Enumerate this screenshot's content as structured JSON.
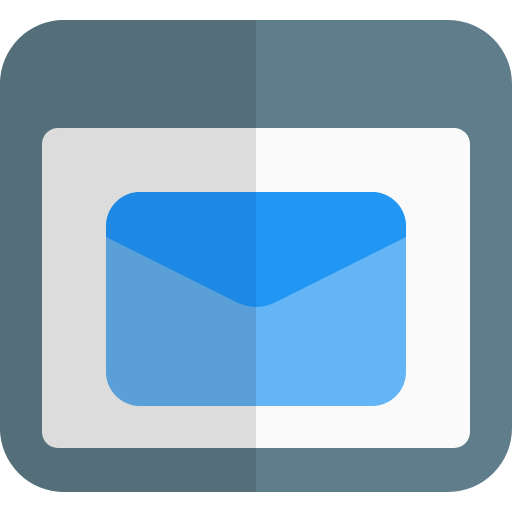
{
  "icon": {
    "name": "browser-mail-icon",
    "description_colors": {
      "frame": "#607D8B",
      "frame_shade": "#546E7A",
      "content": "#FAFAFA",
      "content_shade": "#DCDCDC",
      "envelope_body": "#64B5F6",
      "envelope_body_shade": "#5A9FD8",
      "envelope_flap": "#2196F3",
      "envelope_flap_shade": "#1E88E5"
    }
  }
}
